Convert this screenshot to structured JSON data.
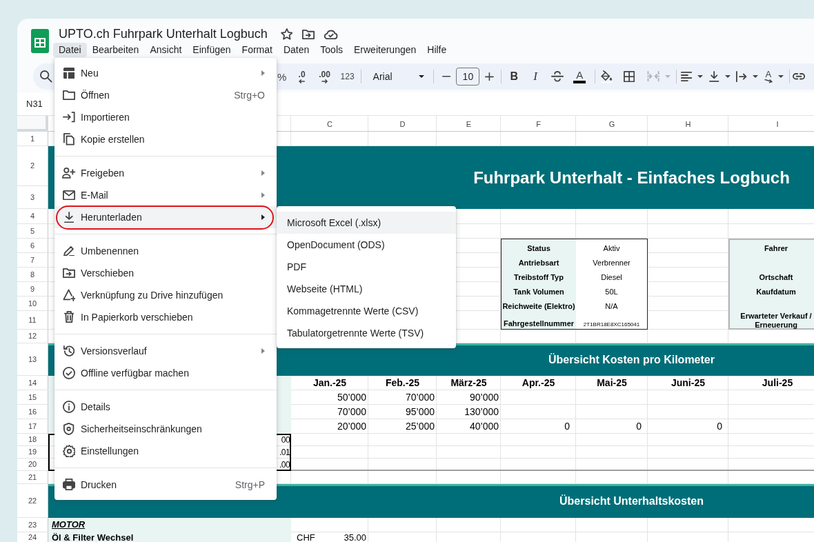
{
  "document": {
    "title": "UPTO.ch Fuhrpark Unterhalt Logbuch"
  },
  "menu_bar": [
    {
      "label": "Datei",
      "selected": true
    },
    {
      "label": "Bearbeiten",
      "selected": false
    },
    {
      "label": "Ansicht",
      "selected": false
    },
    {
      "label": "Einfügen",
      "selected": false
    },
    {
      "label": "Format",
      "selected": false
    },
    {
      "label": "Daten",
      "selected": false
    },
    {
      "label": "Tools",
      "selected": false
    },
    {
      "label": "Erweiterungen",
      "selected": false
    },
    {
      "label": "Hilfe",
      "selected": false
    }
  ],
  "toolbar": {
    "percent": "%",
    "decrease_decimals": ".0",
    "increase_decimals": ".00",
    "number_format": "123",
    "font": "Arial",
    "font_size": "10",
    "bold": "B",
    "italic": "I",
    "text_color": "A",
    "merge_cells": {
      "disabled": true
    },
    "text_rotation": "A"
  },
  "name_box": "N31",
  "file_menu": {
    "sections": [
      {
        "items": [
          {
            "label": "Neu",
            "submenu": true,
            "expanded": false,
            "circled": false
          },
          {
            "label": "Öffnen",
            "shortcut": "Strg+O",
            "submenu": false,
            "expanded": false,
            "circled": false
          },
          {
            "label": "Importieren",
            "submenu": false,
            "expanded": false,
            "circled": false
          },
          {
            "label": "Kopie erstellen",
            "submenu": false,
            "expanded": false,
            "circled": false
          }
        ]
      },
      {
        "items": [
          {
            "label": "Freigeben",
            "submenu": true,
            "expanded": false,
            "circled": false
          },
          {
            "label": "E-Mail",
            "submenu": true,
            "expanded": false,
            "circled": false
          },
          {
            "label": "Herunterladen",
            "submenu": true,
            "expanded": true,
            "circled": true
          }
        ]
      },
      {
        "items": [
          {
            "label": "Umbenennen",
            "submenu": false,
            "expanded": false,
            "circled": false
          },
          {
            "label": "Verschieben",
            "submenu": false,
            "expanded": false,
            "circled": false
          },
          {
            "label": "Verknüpfung zu Drive hinzufügen",
            "submenu": false,
            "expanded": false,
            "circled": false
          },
          {
            "label": "In Papierkorb verschieben",
            "submenu": false,
            "expanded": false,
            "circled": false
          }
        ]
      },
      {
        "items": [
          {
            "label": "Versionsverlauf",
            "submenu": true,
            "expanded": false,
            "circled": false
          },
          {
            "label": "Offline verfügbar machen",
            "submenu": false,
            "expanded": false,
            "circled": false
          }
        ]
      },
      {
        "items": [
          {
            "label": "Details",
            "submenu": false,
            "expanded": false,
            "circled": false
          },
          {
            "label": "Sicherheitseinschränkungen",
            "submenu": false,
            "expanded": false,
            "circled": false
          },
          {
            "label": "Einstellungen",
            "submenu": false,
            "expanded": false,
            "circled": false
          }
        ]
      },
      {
        "items": [
          {
            "label": "Drucken",
            "shortcut": "Strg+P",
            "submenu": false,
            "expanded": false,
            "circled": false
          }
        ]
      }
    ]
  },
  "download_submenu": {
    "items": [
      {
        "label": "Microsoft Excel (.xlsx)",
        "highlighted": true
      },
      {
        "label": "OpenDocument (ODS)",
        "highlighted": false
      },
      {
        "label": "PDF",
        "highlighted": false
      },
      {
        "label": "Webseite (HTML)",
        "highlighted": false
      },
      {
        "label": "Kommagetrennte Werte (CSV)",
        "highlighted": false
      },
      {
        "label": "Tabulatorgetrennte Werte (TSV)",
        "highlighted": false
      }
    ]
  },
  "sheet": {
    "column_headers": [
      "C",
      "D",
      "E",
      "F",
      "G",
      "H",
      "I"
    ],
    "row_headers": [
      "1",
      "2",
      "3",
      "4",
      "5",
      "6",
      "7",
      "8",
      "9",
      "10",
      "11",
      "12",
      "13",
      "14",
      "15",
      "16",
      "17",
      "18",
      "19",
      "20",
      "21",
      "22",
      "23",
      "24"
    ],
    "title": "Fuhrpark Unterhalt - Einfaches Logbuch",
    "vehicle_info": [
      {
        "label": "Status",
        "value": "Aktiv"
      },
      {
        "label": "Antriebsart",
        "value": "Verbrenner"
      },
      {
        "label": "Treibstoff Typ",
        "value": "Diesel"
      },
      {
        "label": "Tank Volumen",
        "value": "50L"
      },
      {
        "label": "Reichweite (Elektro)",
        "value": "N/A"
      },
      {
        "label": "Fahrgestellnummer",
        "value": "2T1BR18E8XC165041"
      }
    ],
    "owner_info": [
      "Fahrer",
      "Ortschaft",
      "Kaufdatum",
      "Erwarteter Verkauf / Erneuerung"
    ],
    "km_overview": {
      "title": "Übersicht Kosten pro Kilometer",
      "months": [
        "Jan.-25",
        "Feb.-25",
        "März-25",
        "Apr.-25",
        "Mai-25",
        "Juni-25",
        "Juli-25"
      ],
      "rows": [
        [
          "50’000",
          "70’000",
          "90’000"
        ],
        [
          "70’000",
          "95’000",
          "130’000"
        ],
        [
          "20’000",
          "25’000",
          "40’000",
          "0",
          "0",
          "0"
        ]
      ],
      "totals": [
        "00",
        ".01",
        ".00"
      ]
    },
    "maintenance": {
      "title": "Übersicht Unterhaltskosten",
      "category": "MOTOR",
      "items": [
        {
          "label": "Öl & Filter Wechsel",
          "currency": "CHF",
          "amount": "35.00"
        }
      ]
    }
  }
}
